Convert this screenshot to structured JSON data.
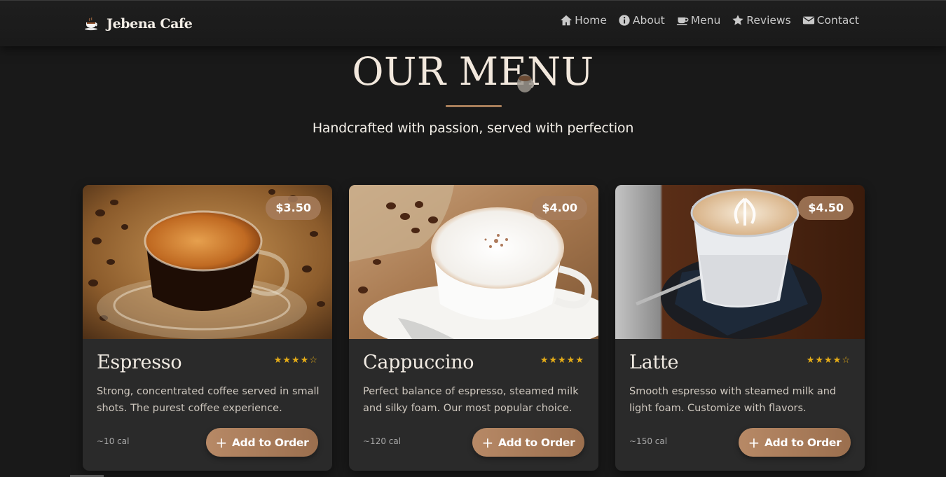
{
  "nav": {
    "brand": "Jebena Cafe",
    "brand_icon": "coffee-cup-icon",
    "links": [
      {
        "label": "Home",
        "icon": "home-icon"
      },
      {
        "label": "About",
        "icon": "info-icon"
      },
      {
        "label": "Menu",
        "icon": "coffee-icon"
      },
      {
        "label": "Reviews",
        "icon": "star-icon"
      },
      {
        "label": "Contact",
        "icon": "envelope-icon"
      }
    ]
  },
  "header": {
    "title": "OUR MENU",
    "subtitle": "Handcrafted with passion, served with perfection"
  },
  "menu": {
    "items": [
      {
        "name": "Espresso",
        "price": "$3.50",
        "stars": "★★★★☆",
        "rating": 4.5,
        "description": "Strong, concentrated coffee served in small shots. The purest coffee experience.",
        "calories": "~10 cal",
        "button": "Add to Order",
        "button_icon": "plus"
      },
      {
        "name": "Cappuccino",
        "price": "$4.00",
        "stars": "★★★★★",
        "rating": 5,
        "description": "Perfect balance of espresso, steamed milk and silky foam. Our most popular choice.",
        "calories": "~120 cal",
        "button": "Add to Order",
        "button_icon": "plus"
      },
      {
        "name": "Latte",
        "price": "$4.50",
        "stars": "★★★★☆",
        "rating": 4.5,
        "description": "Smooth espresso with steamed milk and light foam. Customize with flavors.",
        "calories": "~150 cal",
        "button": "Add to Order",
        "button_icon": "plus"
      }
    ]
  },
  "colors": {
    "background": "#191919",
    "card": "#2a2a2a",
    "accent": "#a77e5a",
    "star": "#e6ad17"
  }
}
